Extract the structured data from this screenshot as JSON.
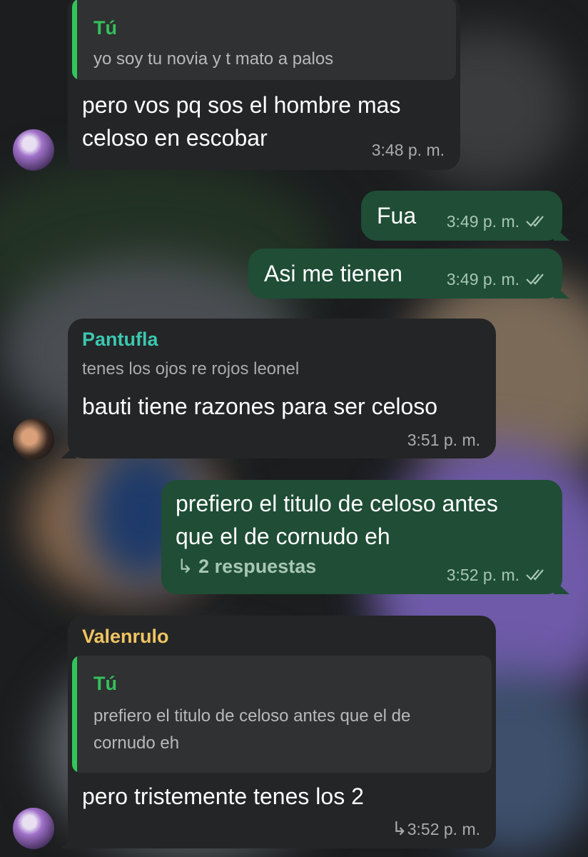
{
  "messages": [
    {
      "quote": {
        "name": "Tú",
        "text": "yo soy tu novia y t mato a palos"
      },
      "text": [
        "pero vos pq sos el hombre mas",
        "celoso en escobar"
      ],
      "time": "3:48 p. m."
    },
    {
      "text": [
        "Fua"
      ],
      "time": "3:49 p. m."
    },
    {
      "text": [
        "Asi me tienen"
      ],
      "time": "3:49 p. m."
    },
    {
      "sender": "Pantufla",
      "sender_color": "#3cc7b0",
      "quote_text": "tenes los ojos re rojos leonel",
      "text": [
        "bauti tiene razones para ser celoso"
      ],
      "time": "3:51 p. m."
    },
    {
      "text": [
        "prefiero el titulo de celoso antes",
        "que el de cornudo eh"
      ],
      "replies": "2 respuestas",
      "time": "3:52 p. m."
    },
    {
      "sender": "Valenrulo",
      "sender_color": "#f0c463",
      "quote": {
        "name": "Tú",
        "text": [
          "prefiero el titulo de celoso antes que el de",
          "cornudo eh"
        ]
      },
      "text": [
        "pero tristemente tenes los 2"
      ],
      "time": "3:52 p. m."
    }
  ],
  "colors": {
    "incoming": "#242526",
    "outgoing": "#1f4d36",
    "quote_accent": "#31c65a"
  },
  "icons": [
    "double-check-icon",
    "reply-arrow-icon",
    "avatar"
  ]
}
